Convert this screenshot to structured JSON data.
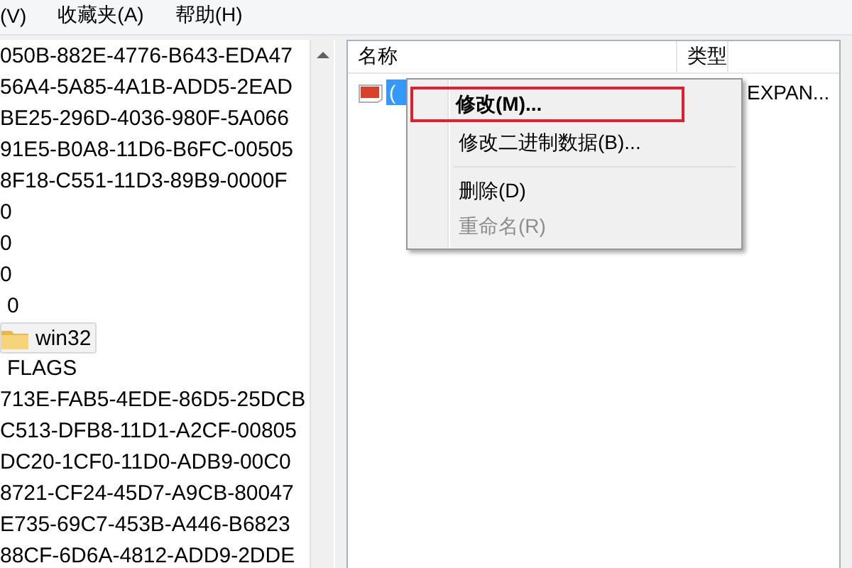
{
  "menu_bar": [
    "(V)",
    "收藏夹(A)",
    "帮助(H)"
  ],
  "tree": [
    {
      "label": "050B-882E-4776-B643-EDA47",
      "selected": false,
      "folder": false
    },
    {
      "label": "56A4-5A85-4A1B-ADD5-2EAD",
      "selected": false,
      "folder": false
    },
    {
      "label": "BE25-296D-4036-980F-5A066",
      "selected": false,
      "folder": false
    },
    {
      "label": "91E5-B0A8-11D6-B6FC-00505",
      "selected": false,
      "folder": false
    },
    {
      "label": "8F18-C551-11D3-89B9-0000F",
      "selected": false,
      "folder": false
    },
    {
      "label": "0",
      "selected": false,
      "folder": false
    },
    {
      "label": "0",
      "selected": false,
      "folder": false
    },
    {
      "label": "0",
      "selected": false,
      "folder": false
    },
    {
      "label": "0",
      "selected": false,
      "folder": false,
      "indented": true
    },
    {
      "label": "win32",
      "selected": true,
      "folder": true
    },
    {
      "label": "FLAGS",
      "selected": false,
      "folder": false,
      "indented": true
    },
    {
      "label": "713E-FAB5-4EDE-86D5-25DCB",
      "selected": false,
      "folder": false
    },
    {
      "label": "C513-DFB8-11D1-A2CF-00805",
      "selected": false,
      "folder": false
    },
    {
      "label": "DC20-1CF0-11D0-ADB9-00C0",
      "selected": false,
      "folder": false
    },
    {
      "label": "8721-CF24-45D7-A9CB-80047",
      "selected": false,
      "folder": false
    },
    {
      "label": "E735-69C7-453B-A446-B6823",
      "selected": false,
      "folder": false
    },
    {
      "label": "88CF-6D6A-4812-ADD9-2DDE",
      "selected": false,
      "folder": false
    }
  ],
  "values": {
    "columns": [
      "名称",
      "类型"
    ],
    "rows": [
      {
        "name": "(",
        "type": "EXPAN...",
        "selected": true
      }
    ]
  },
  "context_menu": [
    {
      "kind": "item",
      "label": "修改(M)...",
      "default": true,
      "disabled": false,
      "annotated": true
    },
    {
      "kind": "item",
      "label": "修改二进制数据(B)...",
      "default": false,
      "disabled": false,
      "annotated": false
    },
    {
      "kind": "separator"
    },
    {
      "kind": "item",
      "label": "删除(D)",
      "default": false,
      "disabled": false,
      "annotated": false
    },
    {
      "kind": "item",
      "label": "重命名(R)",
      "default": false,
      "disabled": true,
      "annotated": false
    }
  ]
}
